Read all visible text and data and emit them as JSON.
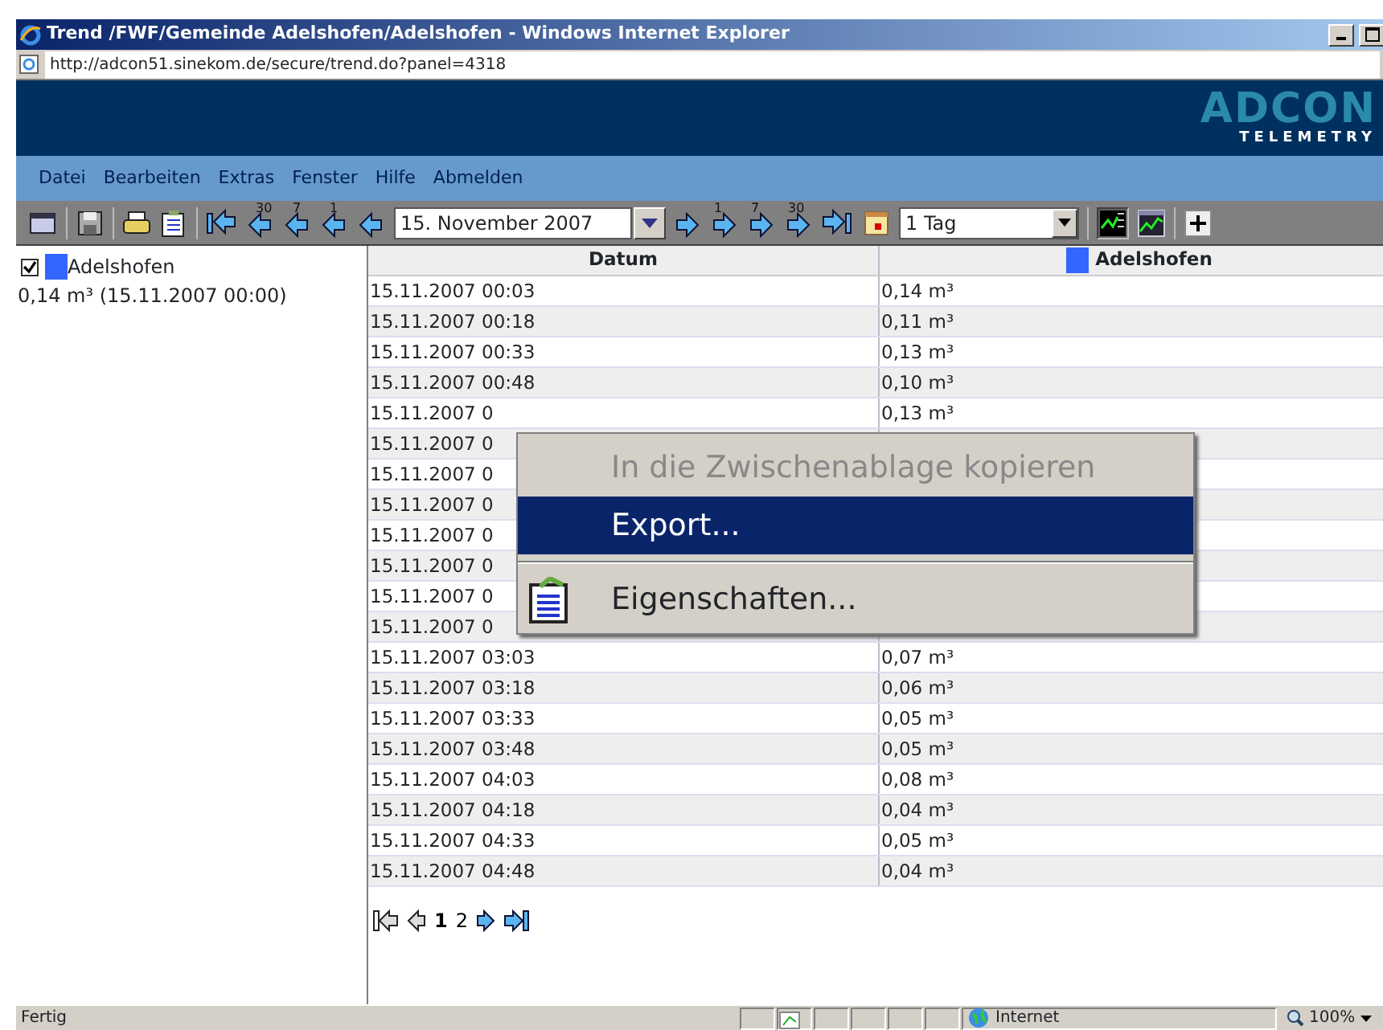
{
  "window": {
    "title": "Trend /FWF/Gemeinde Adelshofen/Adelshofen - Windows Internet Explorer",
    "address": "http://adcon51.sinekom.de/secure/trend.do?panel=4318"
  },
  "logo": {
    "text": "ADCON",
    "subtext": "TELEMETRY"
  },
  "menu": [
    "Datei",
    "Bearbeiten",
    "Extras",
    "Fenster",
    "Hilfe",
    "Abmelden"
  ],
  "toolbar": [
    {
      "kind": "window"
    },
    {
      "kind": "sep"
    },
    {
      "kind": "save"
    },
    {
      "kind": "sep"
    },
    {
      "kind": "print"
    },
    {
      "kind": "properties"
    },
    {
      "kind": "sep"
    },
    {
      "kind": "first"
    },
    {
      "kind": "back",
      "label": "30"
    },
    {
      "kind": "back",
      "label": "7"
    },
    {
      "kind": "back",
      "label": "1"
    },
    {
      "kind": "back"
    },
    {
      "kind": "date",
      "value": "15. November 2007"
    },
    {
      "kind": "next"
    },
    {
      "kind": "next",
      "label": "1"
    },
    {
      "kind": "next",
      "label": "7"
    },
    {
      "kind": "next",
      "label": "30"
    },
    {
      "kind": "last"
    },
    {
      "kind": "calendar"
    },
    {
      "kind": "select",
      "value": "1 Tag"
    },
    {
      "kind": "sep"
    },
    {
      "kind": "table-chart",
      "pressed": true
    },
    {
      "kind": "chart",
      "pressed": false
    },
    {
      "kind": "sep"
    },
    {
      "kind": "plus"
    }
  ],
  "legend": {
    "name": "Adelshofen",
    "checked": true,
    "color": "#3366ff",
    "reading": "0,14 m³ (15.11.2007 00:00)"
  },
  "table": {
    "columns": [
      {
        "label": "Datum"
      },
      {
        "label": "Adelshofen",
        "color": "#3366ff"
      }
    ],
    "rows": [
      [
        "15.11.2007 00:03",
        "0,14 m³"
      ],
      [
        "15.11.2007 00:18",
        "0,11 m³"
      ],
      [
        "15.11.2007 00:33",
        "0,13 m³"
      ],
      [
        "15.11.2007 00:48",
        "0,10 m³"
      ],
      [
        "15.11.2007 0",
        "0,13 m³"
      ],
      [
        "15.11.2007 0",
        null
      ],
      [
        "15.11.2007 0",
        null
      ],
      [
        "15.11.2007 0",
        null
      ],
      [
        "15.11.2007 0",
        null
      ],
      [
        "15.11.2007 0",
        null
      ],
      [
        "15.11.2007 0",
        null
      ],
      [
        "15.11.2007 0",
        null
      ],
      [
        "15.11.2007 03:03",
        "0,07 m³"
      ],
      [
        "15.11.2007 03:18",
        "0,06 m³"
      ],
      [
        "15.11.2007 03:33",
        "0,05 m³"
      ],
      [
        "15.11.2007 03:48",
        "0,05 m³"
      ],
      [
        "15.11.2007 04:03",
        "0,08 m³"
      ],
      [
        "15.11.2007 04:18",
        "0,04 m³"
      ],
      [
        "15.11.2007 04:33",
        "0,05 m³"
      ],
      [
        "15.11.2007 04:48",
        "0,04 m³"
      ]
    ]
  },
  "pagination": [
    {
      "kind": "first"
    },
    {
      "kind": "prev"
    },
    {
      "kind": "page",
      "label": "1",
      "selected": true
    },
    {
      "kind": "page",
      "label": "2",
      "selected": false
    },
    {
      "kind": "next"
    },
    {
      "kind": "last"
    }
  ],
  "context_menu": [
    {
      "kind": "item",
      "label": "In die Zwischenablage kopieren",
      "disabled": true,
      "selected": false
    },
    {
      "kind": "item",
      "label": "Export...",
      "disabled": false,
      "selected": true
    },
    {
      "kind": "separator"
    },
    {
      "kind": "item",
      "label": "Eigenschaften...",
      "disabled": false,
      "selected": false,
      "icon": true
    }
  ],
  "status_bar": {
    "text": "Fertig",
    "zone": "Internet",
    "zoom": "100%"
  }
}
